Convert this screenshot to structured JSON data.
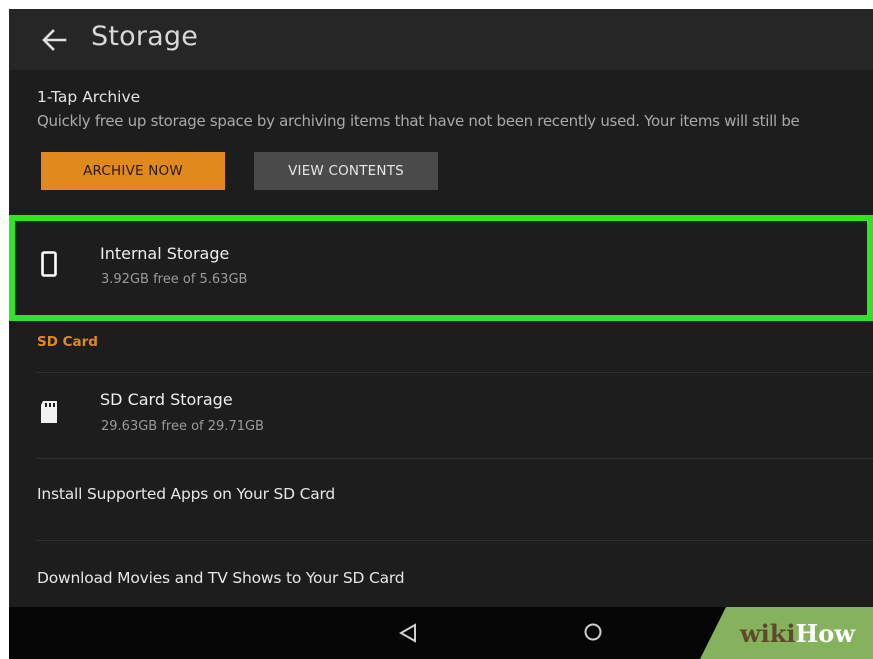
{
  "header": {
    "back_icon": "back-arrow-icon",
    "title": "Storage"
  },
  "archive": {
    "title": "1-Tap Archive",
    "description": "Quickly free up storage space by archiving items that have not been recently used. Your items will still be",
    "archive_button": "ARCHIVE NOW",
    "view_button": "VIEW CONTENTS"
  },
  "internal": {
    "icon": "phone-icon",
    "title": "Internal Storage",
    "subtitle": "3.92GB free of 5.63GB"
  },
  "sd": {
    "section_label": "SD Card",
    "storage": {
      "icon": "sd-card-icon",
      "title": "SD Card Storage",
      "subtitle": "29.63GB free of 29.71GB"
    },
    "install_apps": "Install Supported Apps on Your SD Card",
    "download_media": "Download Movies and TV Shows to Your SD Card"
  },
  "navbar": {
    "back_icon": "nav-back-triangle-icon",
    "home_icon": "nav-home-circle-icon"
  },
  "watermark": {
    "wiki": "wiki",
    "how": "How"
  },
  "colors": {
    "accent": "#e0891d",
    "highlight": "#2fe327",
    "background": "#1d1d1d"
  }
}
